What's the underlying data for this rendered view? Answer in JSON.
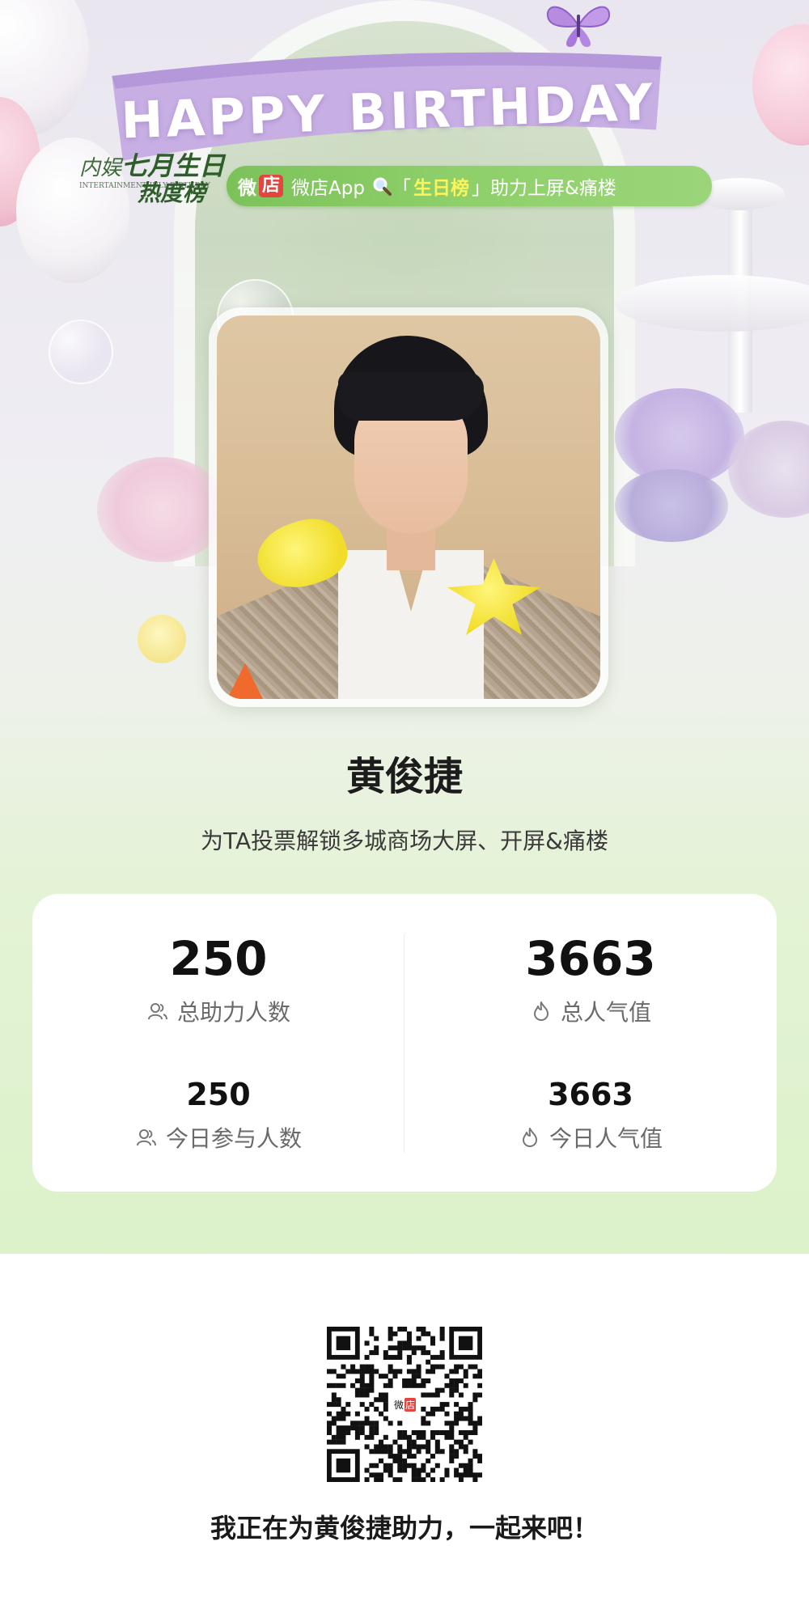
{
  "banner": {
    "text": "HAPPY BIRTHDAY"
  },
  "logo": {
    "prefix": "内娱",
    "highlight": "七月生日",
    "sub": "INTERTAINMENT JULY BIRTHDAY",
    "suffix": "热度榜"
  },
  "pill": {
    "brand_wei": "微",
    "brand_dian": "店",
    "app_label": "微店App",
    "bracket_left": "「",
    "rank_label": "生日榜",
    "bracket_right": "」",
    "action_text": "助力上屏&痛楼"
  },
  "profile": {
    "name": "黄俊捷",
    "subtitle": "为TA投票解锁多城商场大屏、开屏&痛楼"
  },
  "stats": {
    "total_helpers": {
      "value": "250",
      "label": "总助力人数",
      "icon": "users-icon"
    },
    "total_popularity": {
      "value": "3663",
      "label": "总人气值",
      "icon": "flame-icon"
    },
    "today_participants": {
      "value": "250",
      "label": "今日参与人数",
      "icon": "users-icon"
    },
    "today_popularity": {
      "value": "3663",
      "label": "今日人气值",
      "icon": "flame-icon"
    }
  },
  "qr": {
    "center_logo_wei": "微",
    "center_logo_dian": "店"
  },
  "cta": {
    "text": "我正在为黄俊捷助力，一起来吧！"
  }
}
